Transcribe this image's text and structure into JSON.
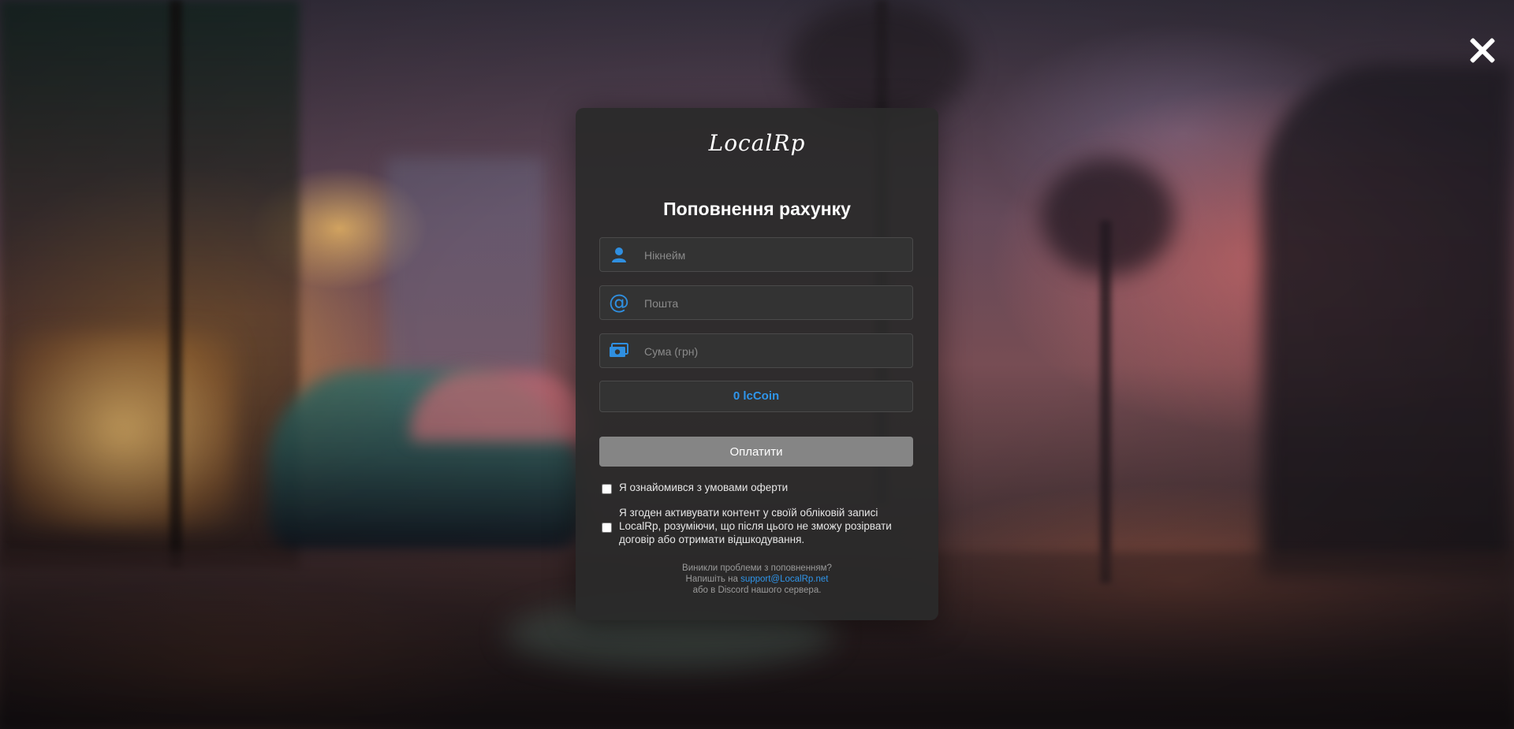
{
  "modal": {
    "logo_text": "LocalRp",
    "title": "Поповнення рахунку",
    "nickname": {
      "placeholder": "Нікнейм",
      "value": "",
      "icon": "user-icon"
    },
    "email": {
      "placeholder": "Пошта",
      "value": "",
      "icon": "at-icon"
    },
    "amount": {
      "placeholder": "Сума (грн)",
      "value": "",
      "icon": "money-icon"
    },
    "coin_display": "0 lcCoin",
    "pay_button": "Оплатити",
    "checkbox_offer": {
      "label": "Я ознайомився з умовами оферти",
      "checked": false
    },
    "checkbox_consent": {
      "label": "Я згоден активувати контент у своїй обліковій записі LocalRp, розуміючи, що після цього не зможу розірвати договір або отримати відшкодування.",
      "checked": false
    },
    "help": {
      "line1": "Виникли проблеми з поповненням?",
      "line2_prefix": "Напишіть на ",
      "email_link": "support@LocalRp.net",
      "line3": "або в Discord нашого сервера."
    }
  },
  "close_icon": "close-icon",
  "colors": {
    "accent": "#2f95ea",
    "modal_bg": "#2a2a2a",
    "pay_button_bg": "#858585"
  }
}
